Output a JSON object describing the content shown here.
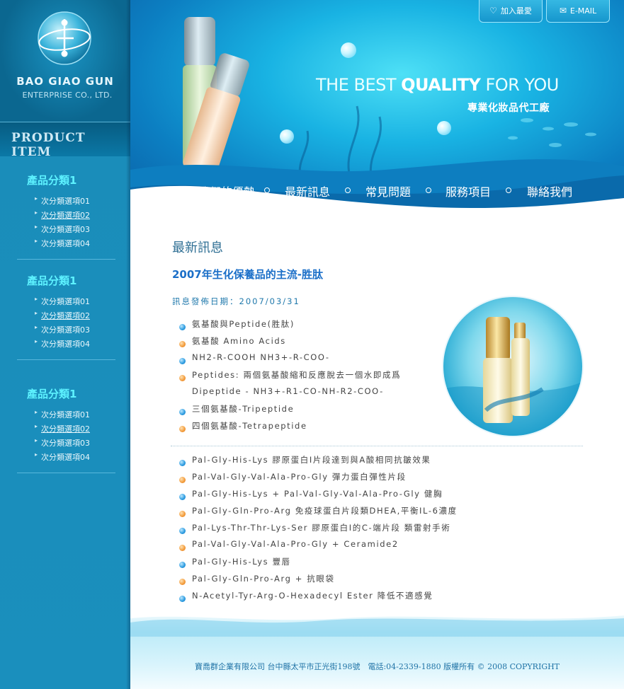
{
  "brand": {
    "name": "BAO GIAO GUN",
    "subtitle": "ENTERPRISE CO., LTD."
  },
  "sidebar": {
    "product_title": "PRODUCT ITEM",
    "categories": [
      {
        "title": "產品分類1",
        "items": [
          "次分類選項01",
          "次分類選項02",
          "次分類選項03",
          "次分類選項04"
        ]
      },
      {
        "title": "產品分類1",
        "items": [
          "次分類選項01",
          "次分類選項02",
          "次分類選項03",
          "次分類選項04"
        ]
      },
      {
        "title": "產品分類1",
        "items": [
          "次分類選項01",
          "次分類選項02",
          "次分類選項03",
          "次分類選項04"
        ]
      }
    ]
  },
  "header": {
    "favorite_label": "加入最愛",
    "email_label": "E-MAIL",
    "tagline_part1": "THE BEST ",
    "tagline_part2": "QUALITY",
    "tagline_part3": " FOR YOU",
    "sub_tagline": "專業化妝品代工廠"
  },
  "nav": [
    "我們的優勢",
    "最新訊息",
    "常見問題",
    "服務項目",
    "聯絡我們"
  ],
  "main": {
    "section_title": "最新訊息",
    "article_title": "2007年生化保養品的主流-胜肽",
    "date_line": "訊息發佈日期：2007/03/31",
    "list1": [
      {
        "text": "氨基酸與Peptide(胜肽)",
        "color": "blue"
      },
      {
        "text": "氨基酸 Amino Acids",
        "color": "orange"
      },
      {
        "text": "NH2-R-COOH NH3+-R-COO-",
        "color": "blue"
      },
      {
        "text": "Peptides: 兩個氨基酸縮和反應脫去一個水即成爲",
        "color": "orange"
      },
      {
        "text": "Dipeptide - NH3+-R1-CO-NH-R2-COO-",
        "color": "none"
      },
      {
        "text": "三個氨基酸-Tripeptide",
        "color": "blue"
      },
      {
        "text": "四個氨基酸-Tetrapeptide",
        "color": "orange"
      }
    ],
    "list2": [
      {
        "text": "Pal-Gly-His-Lys 膠原蛋白I片段達到與A酸相同抗皺效果",
        "color": "blue"
      },
      {
        "text": "Pal-Val-Gly-Val-Ala-Pro-Gly 彈力蛋白彈性片段",
        "color": "orange"
      },
      {
        "text": "Pal-Gly-His-Lys + Pal-Val-Gly-Val-Ala-Pro-Gly 健胸",
        "color": "blue"
      },
      {
        "text": "Pal-Gly-Gln-Pro-Arg 免疫球蛋白片段類DHEA,平衡IL-6濃度",
        "color": "orange"
      },
      {
        "text": "Pal-Lys-Thr-Thr-Lys-Ser 膠原蛋白I的C-端片段 類雷射手術",
        "color": "blue"
      },
      {
        "text": "Pal-Val-Gly-Val-Ala-Pro-Gly + Ceramide2",
        "color": "orange"
      },
      {
        "text": "Pal-Gly-His-Lys 豐唇",
        "color": "blue"
      },
      {
        "text": "Pal-Gly-Gln-Pro-Arg + 抗眼袋",
        "color": "orange"
      },
      {
        "text": "N-Acetyl-Tyr-Arg-O-Hexadecyl Ester 降低不適感覺",
        "color": "blue"
      }
    ]
  },
  "footer": {
    "text": "寶喬群企業有限公司 台中縣太平市正光街198號　電話:04-2339-1880 版權所有 © 2008 COPYRIGHT"
  },
  "colors": {
    "sidebar": "#1a8fbd",
    "accent_cyan": "#5df2ff",
    "title_blue": "#1b6fc8",
    "bullet_blue": "#2b9be0",
    "bullet_orange": "#f39b3a"
  }
}
